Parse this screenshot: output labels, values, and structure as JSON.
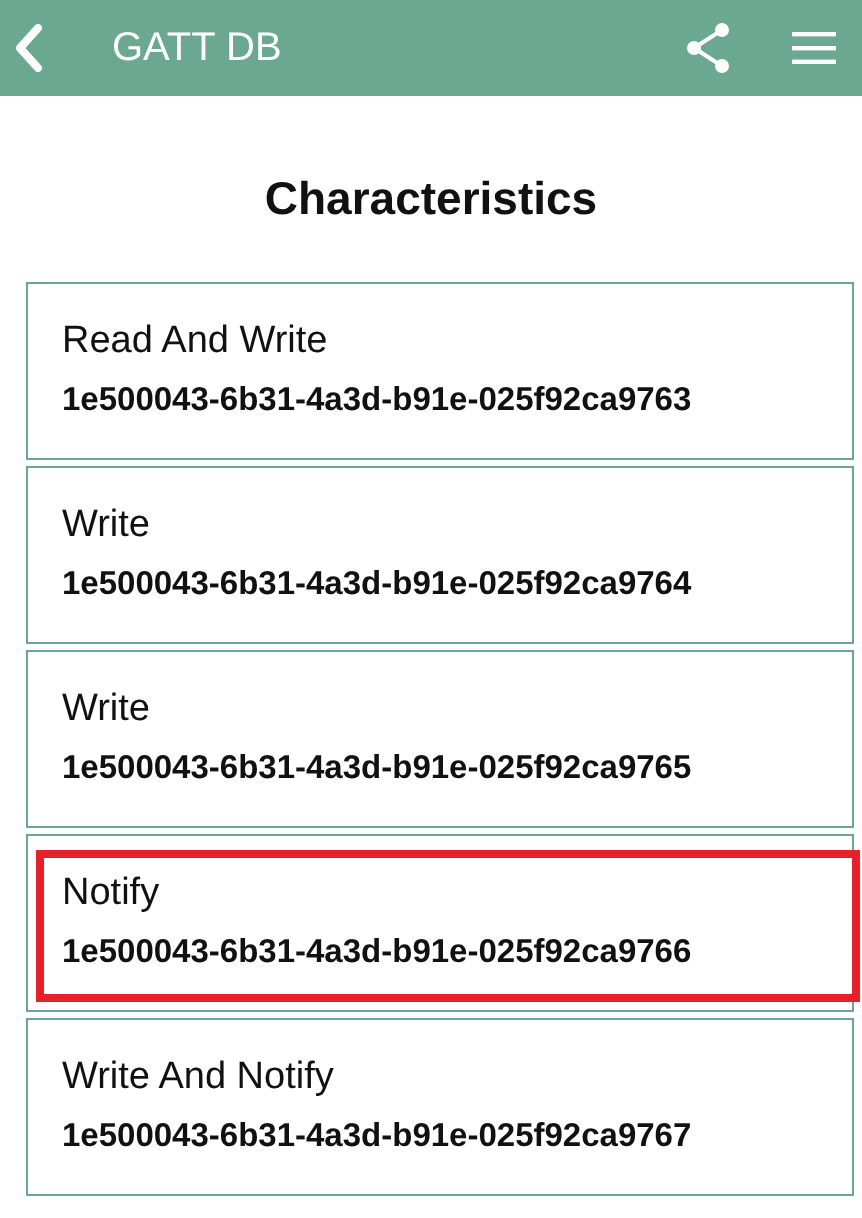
{
  "app_bar": {
    "title": "GATT DB"
  },
  "heading": "Characteristics",
  "characteristics": [
    {
      "name": "Read And Write",
      "uuid": "1e500043-6b31-4a3d-b91e-025f92ca9763",
      "highlighted": false
    },
    {
      "name": "Write",
      "uuid": "1e500043-6b31-4a3d-b91e-025f92ca9764",
      "highlighted": false
    },
    {
      "name": "Write",
      "uuid": "1e500043-6b31-4a3d-b91e-025f92ca9765",
      "highlighted": false
    },
    {
      "name": "Notify",
      "uuid": "1e500043-6b31-4a3d-b91e-025f92ca9766",
      "highlighted": true
    },
    {
      "name": "Write And Notify",
      "uuid": "1e500043-6b31-4a3d-b91e-025f92ca9767",
      "highlighted": false
    }
  ]
}
